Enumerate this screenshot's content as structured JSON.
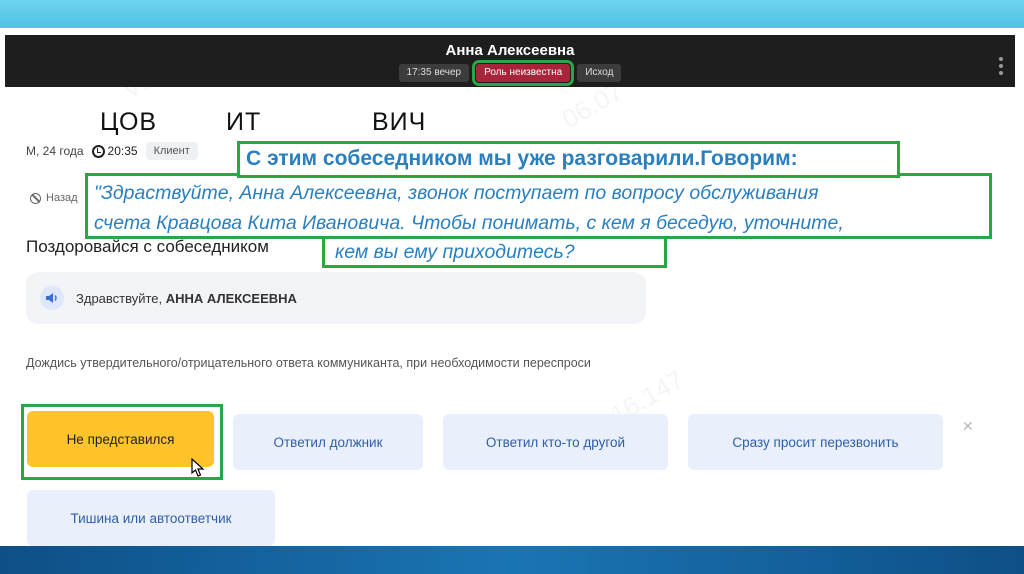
{
  "header": {
    "name": "Анна Алексеевна",
    "time_pill": "17:35 вечер",
    "role_pill": "Роль неизвестна",
    "outcome_pill": "Исход"
  },
  "name_fragments": [
    "ЦОВ",
    "ИТ",
    "ВИЧ"
  ],
  "info": {
    "age": "М, 24 года",
    "time": "20:35",
    "badge": "Клиент"
  },
  "back_label": "Назад",
  "section_title": "Поздоровайся с собеседником",
  "greeting": {
    "prefix": "Здравствуйте, ",
    "name": "АННА АЛЕКСЕЕВНА"
  },
  "instruction": "Дождись утвердительного/отрицательного ответа коммуниканта, при необходимости переспроси",
  "answers": [
    "Не представился",
    "Ответил должник",
    "Ответил кто-то другой",
    "Сразу просит перезвонить",
    "Тишина или автоответчик"
  ],
  "callout": {
    "title": "С этим собеседником мы уже разговарили.Говорим:",
    "quote_line1": "\"Здраствуйте, Анна Алексеевна, звонок поступает по вопросу обслуживания",
    "quote_line2": "счета Кравцова Кита Ивановича. Чтобы понимать, с кем я беседую, уточните,",
    "quote_line3": "кем вы ему приходитесь?"
  },
  "colors": {
    "accent_green": "#27a844",
    "callout_text": "#2a7fbf",
    "primary_button": "#ffc42a",
    "secondary_button": "#eaf0fb",
    "role_pill": "#a8243a"
  }
}
